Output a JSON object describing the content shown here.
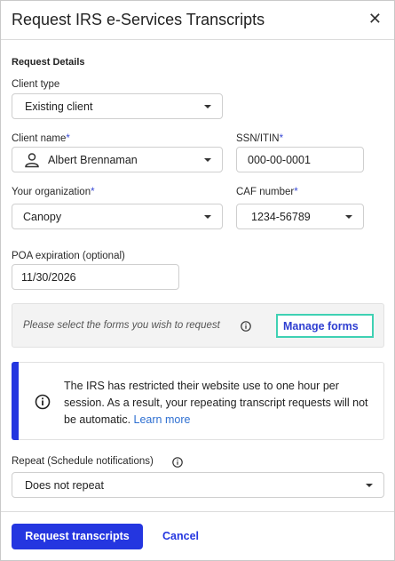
{
  "dialog": {
    "title": "Request IRS e-Services Transcripts",
    "close_icon": "close-icon"
  },
  "request_details": {
    "section_title": "Request Details",
    "client_type": {
      "label": "Client type",
      "value": "Existing client"
    },
    "client_name": {
      "label": "Client name",
      "required_mark": "*",
      "value": "Albert Brennaman",
      "icon": "person-icon"
    },
    "ssn": {
      "label": "SSN/ITIN",
      "required_mark": "*",
      "value": "000-00-0001"
    },
    "organization": {
      "label": "Your organization",
      "required_mark": "*",
      "value": "Canopy"
    },
    "caf_number": {
      "label": "CAF number",
      "required_mark": "*",
      "value": "1234-56789"
    },
    "poa_expiration": {
      "label": "POA expiration (optional)",
      "value": "11/30/2026"
    }
  },
  "forms": {
    "prompt": "Please select the forms you wish to request",
    "info_icon": "info-icon",
    "manage_label": "Manage forms"
  },
  "alert": {
    "icon": "info-icon",
    "text": "The IRS has restricted their website use to one hour per session. As a result, your repeating transcript requests will not be automatic.",
    "link": "Learn more",
    "accent_color": "#2436e0"
  },
  "repeat": {
    "label": "Repeat (Schedule notifications)",
    "info_icon": "info-icon",
    "value": "Does not repeat"
  },
  "footer": {
    "primary_label": "Request transcripts",
    "cancel_label": "Cancel"
  },
  "colors": {
    "primary": "#2436e0",
    "highlight": "#3fd1b3",
    "link": "#2e6fd1"
  }
}
